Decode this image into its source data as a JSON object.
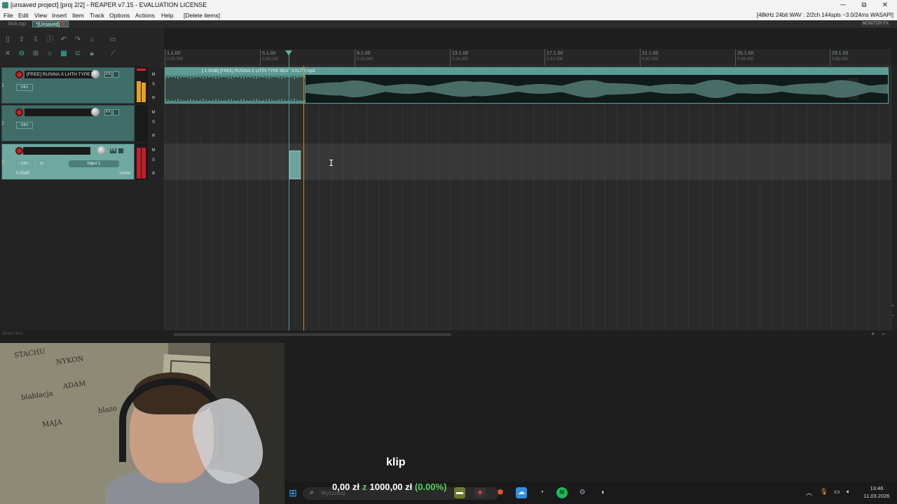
{
  "window": {
    "title": "[unsaved project] [proj 2/2] - REAPER v7.15 - EVALUATION LICENSE",
    "minimize": "─",
    "maximize": "⧉",
    "close": "✕"
  },
  "menu": {
    "items": [
      "File",
      "Edit",
      "View",
      "Insert",
      "Item",
      "Track",
      "Options",
      "Actions",
      "Help",
      "[Delete items]"
    ],
    "status": "[48kHz 24bit WAV : 2/2ch 144spls ~3.0/24ms WASAPI]"
  },
  "project_tabs": {
    "tab1": "blok.rpp",
    "tab2": "*[Unsaved]",
    "monitor_fx": "MONITOR FX"
  },
  "ruler": {
    "marks": [
      {
        "bar": "1.1.00",
        "time": "0:00.000"
      },
      {
        "bar": "5.1.00",
        "time": "0:08.000"
      },
      {
        "bar": "9.1.00",
        "time": "0:16.000"
      },
      {
        "bar": "13.1.00",
        "time": "0:24.000"
      },
      {
        "bar": "17.1.00",
        "time": "0:32.000"
      },
      {
        "bar": "21.1.00",
        "time": "0:40.000"
      },
      {
        "bar": "25.1.00",
        "time": "0:48.000"
      },
      {
        "bar": "29.1.00",
        "time": "0:56.000"
      }
    ]
  },
  "tracks": [
    {
      "number": "1",
      "name": "[FREE] RUSINA X LHTH TYPE",
      "fx": "FX",
      "trim": "trim"
    },
    {
      "number": "2",
      "name": "",
      "fx": "FX",
      "trim": "trim"
    },
    {
      "number": "3",
      "name": "",
      "fx": "FX",
      "trim": "trim",
      "input": "Input 1",
      "volume": "0.00dB",
      "pan": "center",
      "monitor": "in"
    }
  ],
  "item": {
    "label": "[-1.00dB] [FREE] RUSINA X LHTH TYPE BEAT 3 KUTY.mp3"
  },
  "status_left": "Select item",
  "overlay": {
    "caption": "klip",
    "donation_amount": "0,00 zł",
    "donation_of": "z",
    "donation_goal": "1000,00 zł",
    "donation_percent": "(0.00%)"
  },
  "taskbar": {
    "search_placeholder": "Wyszukaj",
    "time": "13:46",
    "date": "11.03.2026"
  },
  "colors": {
    "track_teal": "#3f6e69",
    "accent": "#5ab4a8",
    "play_cursor": "#d8892a",
    "donation_green": "#54d35a"
  }
}
